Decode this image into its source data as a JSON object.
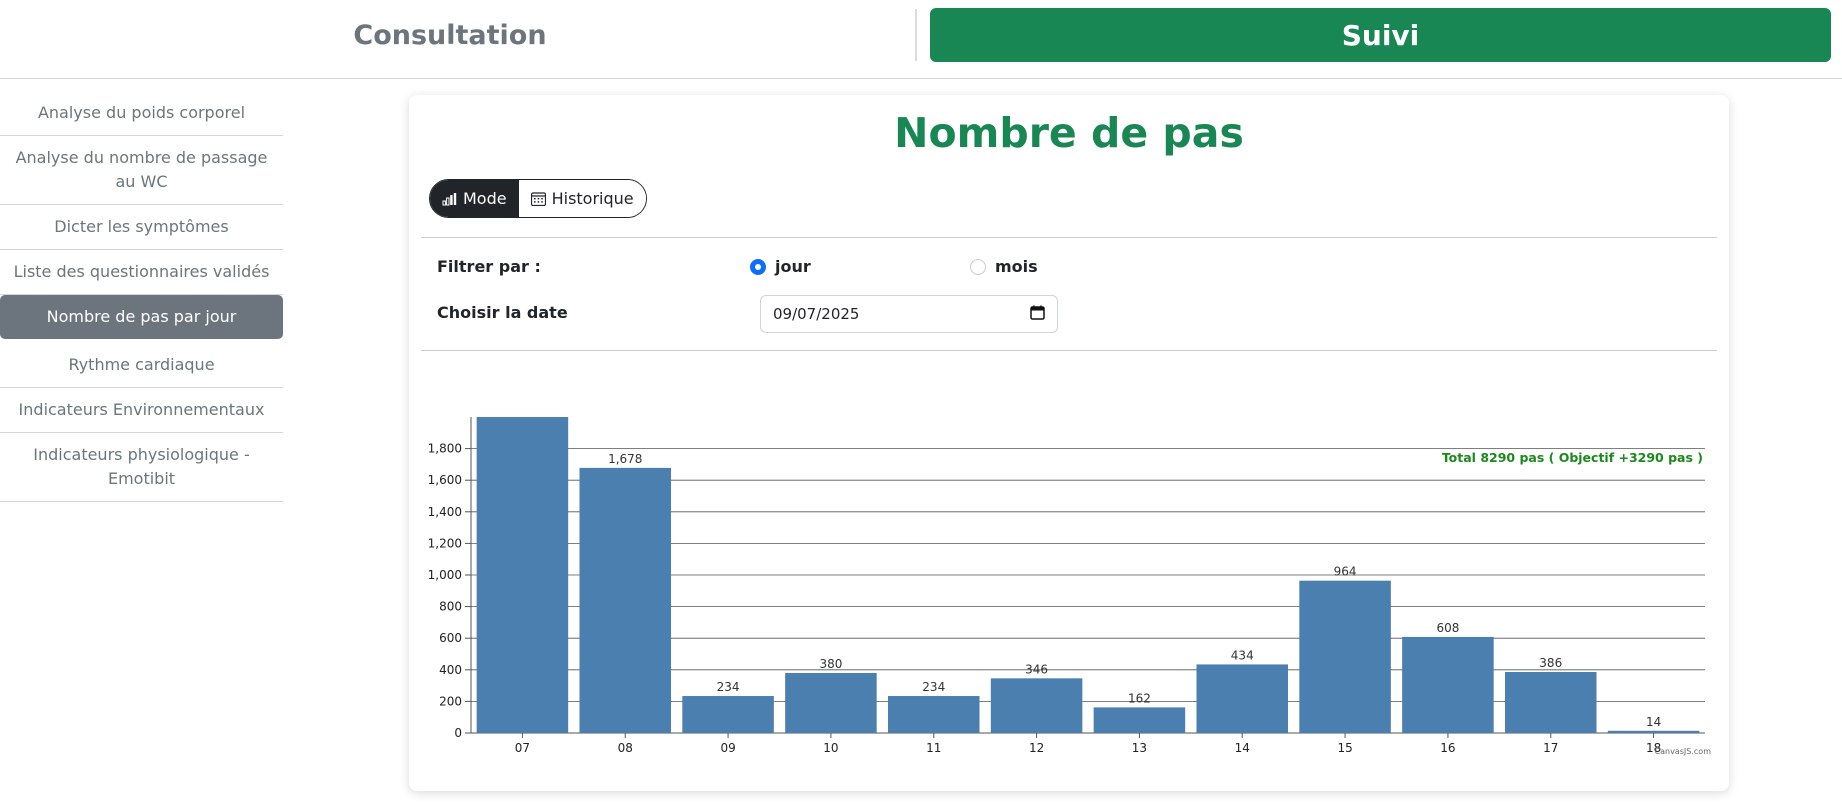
{
  "header": {
    "tab_consultation": "Consultation",
    "tab_suivi": "Suivi",
    "accent": "#198754"
  },
  "sidebar": {
    "items": [
      {
        "label": "Analyse du poids corporel"
      },
      {
        "label": "Analyse du nombre de passage au WC"
      },
      {
        "label": "Dicter les symptômes"
      },
      {
        "label": "Liste des questionnaires validés"
      },
      {
        "label": "Nombre de pas par jour",
        "active": true
      },
      {
        "label": "Rythme cardiaque"
      },
      {
        "label": "Indicateurs Environnementaux"
      },
      {
        "label": "Indicateurs physiologique - Emotibit"
      }
    ]
  },
  "main": {
    "title": "Nombre de pas",
    "toggle": {
      "mode_label": "Mode",
      "history_label": "Historique",
      "mode_icon": "bar-chart-icon",
      "history_icon": "calendar-icon"
    },
    "filter": {
      "label": "Filtrer par :",
      "options": [
        {
          "label": "jour",
          "checked": true
        },
        {
          "label": "mois",
          "checked": false
        }
      ]
    },
    "date": {
      "label": "Choisir la date",
      "value": "09/07/2025",
      "icon": "calendar-icon"
    }
  },
  "chart_data": {
    "type": "bar",
    "categories": [
      "07",
      "08",
      "09",
      "10",
      "11",
      "12",
      "13",
      "14",
      "15",
      "16",
      "17",
      "18"
    ],
    "values": [
      2000,
      1678,
      234,
      380,
      234,
      346,
      162,
      434,
      964,
      608,
      386,
      14
    ],
    "value_labels": [
      "",
      "1,678",
      "234",
      "380",
      "234",
      "346",
      "162",
      "434",
      "964",
      "608",
      "386",
      "14"
    ],
    "yticks": [
      "0",
      "200",
      "400",
      "600",
      "800",
      "1,000",
      "1,200",
      "1,400",
      "1,600",
      "1,800"
    ],
    "ylim": [
      0,
      2000
    ],
    "grid": true,
    "bar_color": "#4a7fb0",
    "annotation": "Total 8290 pas ( Objectif +3290 pas )",
    "annotation_color": "#1a8a1a",
    "credit": "CanvasJS.com"
  }
}
